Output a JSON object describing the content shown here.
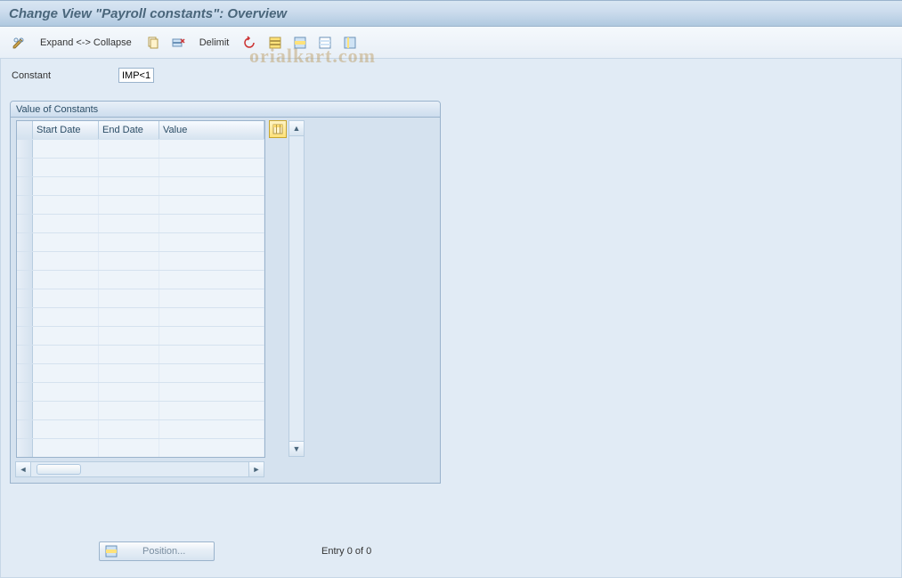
{
  "title": "Change View \"Payroll constants\": Overview",
  "toolbar": {
    "expand_collapse": "Expand <-> Collapse",
    "delimit": "Delimit"
  },
  "constant": {
    "label": "Constant",
    "value": "IMP<1"
  },
  "panel": {
    "title": "Value of Constants",
    "columns": {
      "start_date": "Start Date",
      "end_date": "End Date",
      "value": "Value"
    },
    "rows": [
      {
        "start_date": "",
        "end_date": "",
        "value": ""
      },
      {
        "start_date": "",
        "end_date": "",
        "value": ""
      },
      {
        "start_date": "",
        "end_date": "",
        "value": ""
      },
      {
        "start_date": "",
        "end_date": "",
        "value": ""
      },
      {
        "start_date": "",
        "end_date": "",
        "value": ""
      },
      {
        "start_date": "",
        "end_date": "",
        "value": ""
      },
      {
        "start_date": "",
        "end_date": "",
        "value": ""
      },
      {
        "start_date": "",
        "end_date": "",
        "value": ""
      },
      {
        "start_date": "",
        "end_date": "",
        "value": ""
      },
      {
        "start_date": "",
        "end_date": "",
        "value": ""
      },
      {
        "start_date": "",
        "end_date": "",
        "value": ""
      },
      {
        "start_date": "",
        "end_date": "",
        "value": ""
      },
      {
        "start_date": "",
        "end_date": "",
        "value": ""
      },
      {
        "start_date": "",
        "end_date": "",
        "value": ""
      },
      {
        "start_date": "",
        "end_date": "",
        "value": ""
      },
      {
        "start_date": "",
        "end_date": "",
        "value": ""
      },
      {
        "start_date": "",
        "end_date": "",
        "value": ""
      }
    ]
  },
  "footer": {
    "position_label": "Position...",
    "entry_text": "Entry 0 of 0"
  },
  "watermark": "orialkart.com"
}
